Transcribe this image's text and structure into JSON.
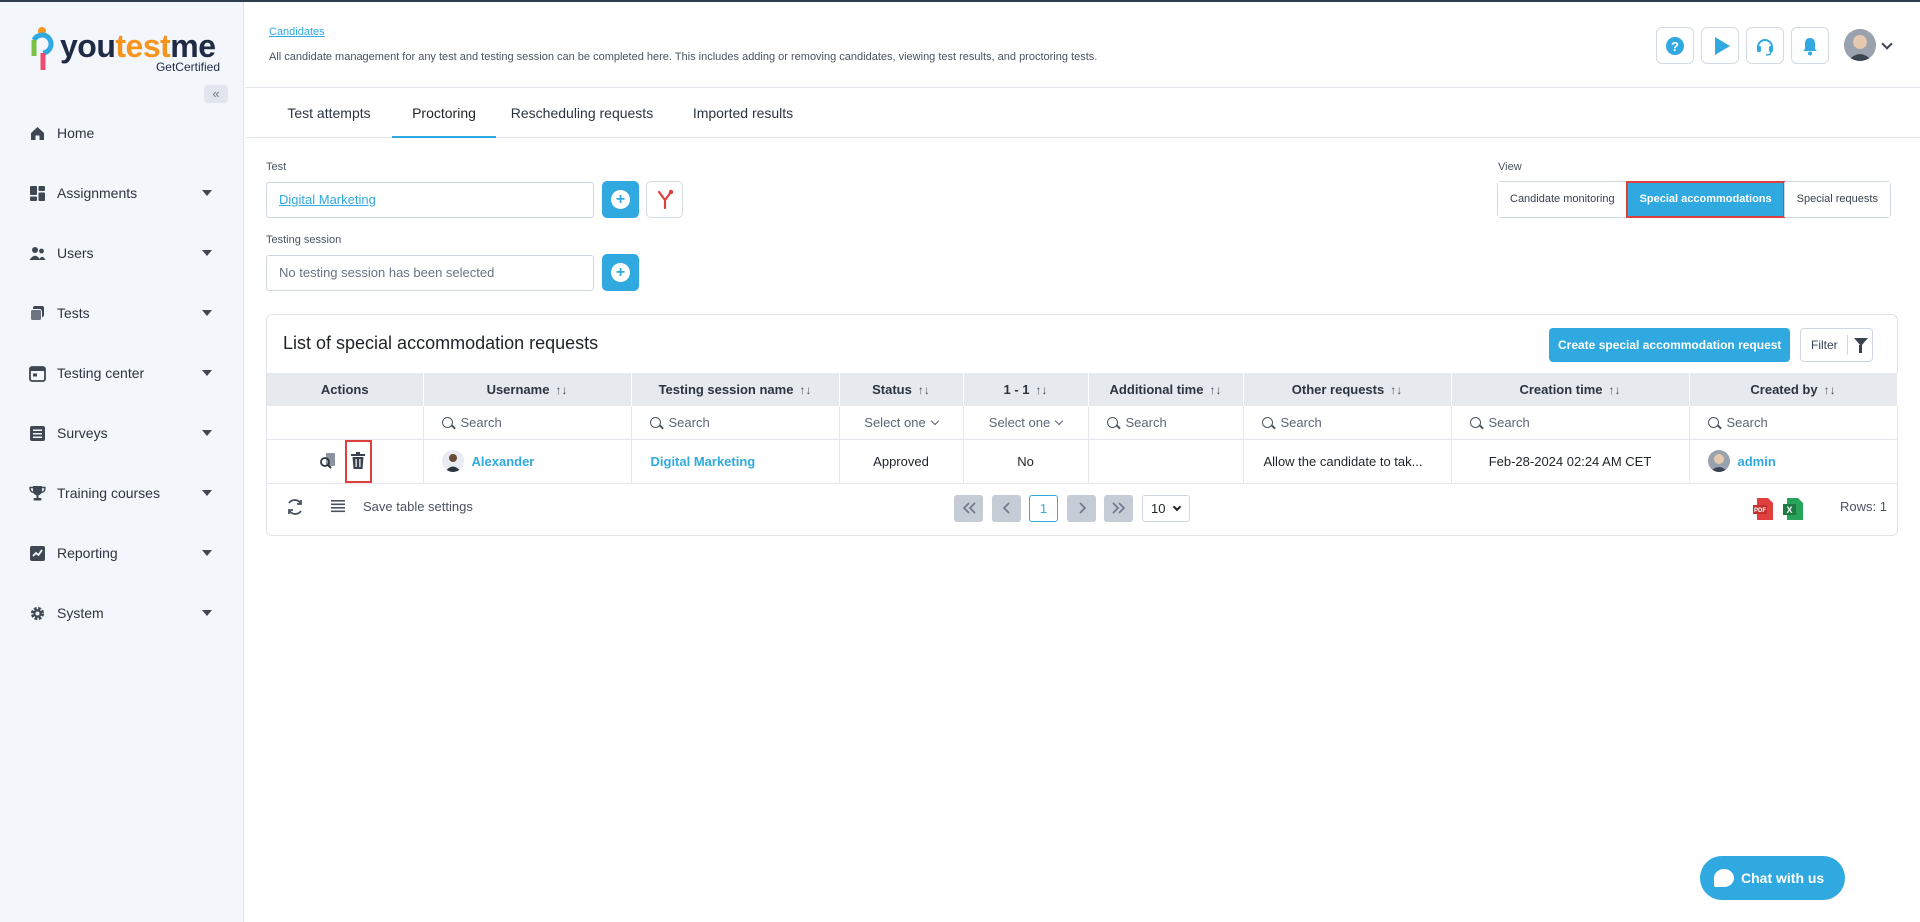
{
  "brand": {
    "logo_you": "you",
    "logo_test": "test",
    "logo_me": "me",
    "logo_sub": "GetCertified",
    "collapse_label": "«"
  },
  "sidebar": {
    "items": [
      {
        "label": "Home",
        "icon": "home-icon",
        "has_submenu": false
      },
      {
        "label": "Assignments",
        "icon": "dashboard-icon",
        "has_submenu": true
      },
      {
        "label": "Users",
        "icon": "users-icon",
        "has_submenu": true
      },
      {
        "label": "Tests",
        "icon": "tests-icon",
        "has_submenu": true
      },
      {
        "label": "Testing center",
        "icon": "calendar-icon",
        "has_submenu": true
      },
      {
        "label": "Surveys",
        "icon": "list-icon",
        "has_submenu": true
      },
      {
        "label": "Training courses",
        "icon": "trophy-icon",
        "has_submenu": true
      },
      {
        "label": "Reporting",
        "icon": "chart-icon",
        "has_submenu": true
      },
      {
        "label": "System",
        "icon": "gear-icon",
        "has_submenu": true
      }
    ]
  },
  "header": {
    "breadcrumb": "Candidates",
    "description": "All candidate management for any test and testing session can be completed here. This includes adding or removing candidates, viewing test results, and proctoring tests."
  },
  "tabs": [
    {
      "label": "Test attempts",
      "active": false
    },
    {
      "label": "Proctoring",
      "active": true
    },
    {
      "label": "Rescheduling requests",
      "active": false
    },
    {
      "label": "Imported results",
      "active": false
    }
  ],
  "form": {
    "test_label": "Test",
    "test_value": "Digital Marketing",
    "session_label": "Testing session",
    "session_placeholder": "No testing session has been selected"
  },
  "view": {
    "label": "View",
    "options": [
      "Candidate monitoring",
      "Special accommodations",
      "Special requests"
    ],
    "active_index": 1
  },
  "panel": {
    "title": "List of special accommodation requests",
    "create_button": "Create special accommodation request",
    "filter_button": "Filter"
  },
  "table": {
    "columns": [
      "Actions",
      "Username",
      "Testing session name",
      "Status",
      "1 - 1",
      "Additional time",
      "Other requests",
      "Creation time",
      "Created by"
    ],
    "sort_glyph": "↑↓",
    "search_placeholder": "Search",
    "select_placeholder": "Select one",
    "rows": [
      {
        "username": "Alexander",
        "session": "Digital Marketing",
        "status": "Approved",
        "one_on_one": "No",
        "additional_time": "",
        "other_requests": "Allow the candidate to tak...",
        "creation_time": "Feb-28-2024 02:24 AM CET",
        "created_by": "admin"
      }
    ]
  },
  "footer": {
    "save_settings": "Save table settings",
    "current_page": "1",
    "per_page": "10",
    "rows_label": "Rows: 1"
  },
  "chat": {
    "label": "Chat with us"
  },
  "colors": {
    "accent": "#2fa9e0",
    "highlight": "#e0403d",
    "sidebar_bg": "#f3f6fb"
  }
}
